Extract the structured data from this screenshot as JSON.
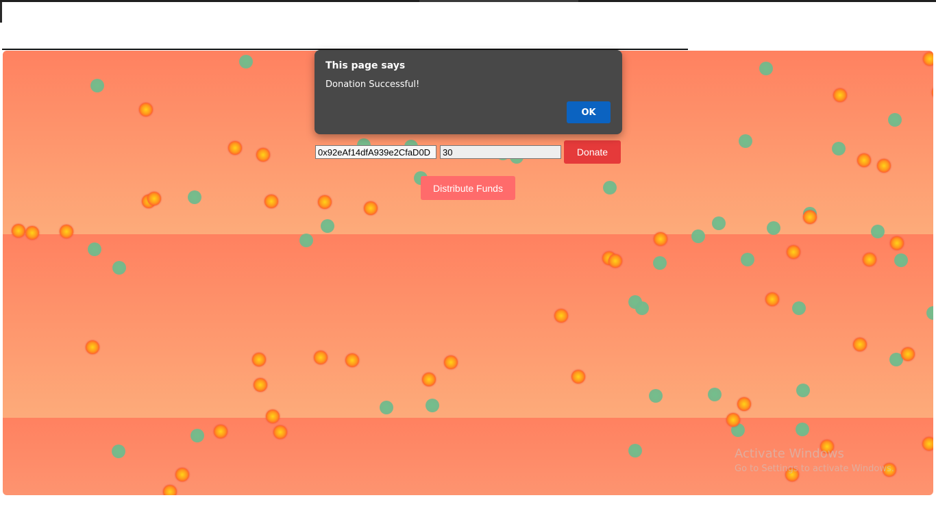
{
  "donation_form": {
    "address_value": "0x92eAf14dfA939e2CfaD0D",
    "amount_value": "30",
    "donate_label": "Donate"
  },
  "distribute_label": "Distribute Funds",
  "alert": {
    "title": "This page says",
    "message": "Donation Successful!",
    "ok_label": "OK"
  },
  "watermark": {
    "title": "Activate Windows",
    "subtitle": "Go to Settings to activate Windows."
  },
  "colors": {
    "gradient_top": "#ff8160",
    "gradient_bottom": "#fdab7a",
    "donate_button": "#e53a3a",
    "distribute_button": "#ff6b6b",
    "alert_background": "#484848",
    "alert_ok": "#0b63c1",
    "fire_dot": "#ff5a2e",
    "mint_dot": "#72b98c"
  }
}
